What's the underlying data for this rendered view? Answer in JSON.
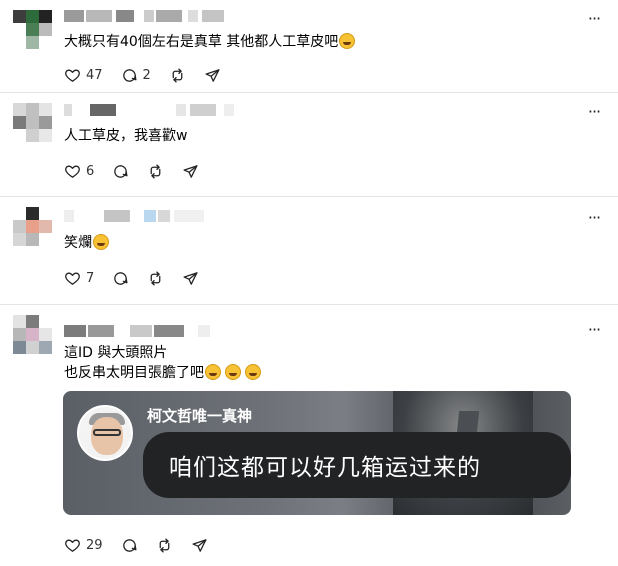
{
  "posts": [
    {
      "text": "大概只有40個左右是真草 其他都人工草皮吧",
      "emoji_count": 1,
      "likes": "47",
      "replies": "2"
    },
    {
      "text": "人工草皮，我喜歡w",
      "likes": "6"
    },
    {
      "text": "笑爛",
      "likes": "7"
    },
    {
      "text_line1": "這ID 與大頭照片",
      "text_line2": "也反串太明目張膽了吧",
      "likes": "29"
    }
  ],
  "meme_card": {
    "name": "柯文哲唯一真神",
    "bubble_text": "咱们这都可以好几箱运过来的"
  },
  "icons": {
    "like": "heart-icon",
    "reply": "comment-icon",
    "repost": "repost-icon",
    "share": "send-icon",
    "more": "more-icon"
  },
  "colors": {
    "divider": "#e5e5e5",
    "text": "#000000",
    "bubble": "#222325"
  }
}
